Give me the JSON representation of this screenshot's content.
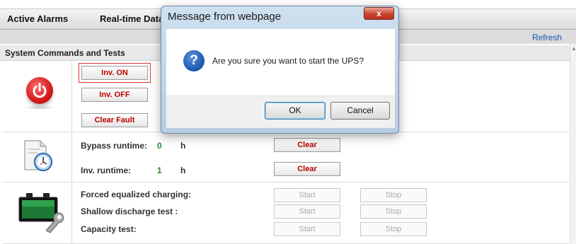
{
  "tabs": [
    {
      "label": "Active Alarms"
    },
    {
      "label": "Real-time Data"
    }
  ],
  "toolbar": {
    "refresh_label": "Refresh"
  },
  "section": {
    "title": "System Commands and Tests"
  },
  "commands": {
    "inv_on_label": "Inv. ON",
    "inv_off_label": "Inv. OFF",
    "clear_fault_label": "Clear Fault"
  },
  "runtime": {
    "bypass_label": "Bypass runtime:",
    "bypass_value": "0",
    "bypass_unit": "h",
    "inv_label": "Inv. runtime:",
    "inv_value": "1",
    "inv_unit": "h",
    "clear_label": "Clear"
  },
  "tests": {
    "items": [
      {
        "label": "Forced equalized charging:"
      },
      {
        "label": "Shallow discharge test :"
      },
      {
        "label": "Capacity test:"
      }
    ],
    "start_label": "Start",
    "stop_label": "Stop"
  },
  "dialog": {
    "title": "Message from webpage",
    "close_glyph": "x",
    "message": "Are you sure you want to start the UPS?",
    "question_glyph": "?",
    "ok_label": "OK",
    "cancel_label": "Cancel"
  },
  "icons": {
    "power": "power-icon",
    "runtime": "clock-document-icon",
    "battery": "battery-wrench-icon",
    "question": "question-icon"
  },
  "colors": {
    "accent_red": "#bb0000",
    "link_blue": "#1a55b0",
    "value_green": "#2a8b2a"
  }
}
